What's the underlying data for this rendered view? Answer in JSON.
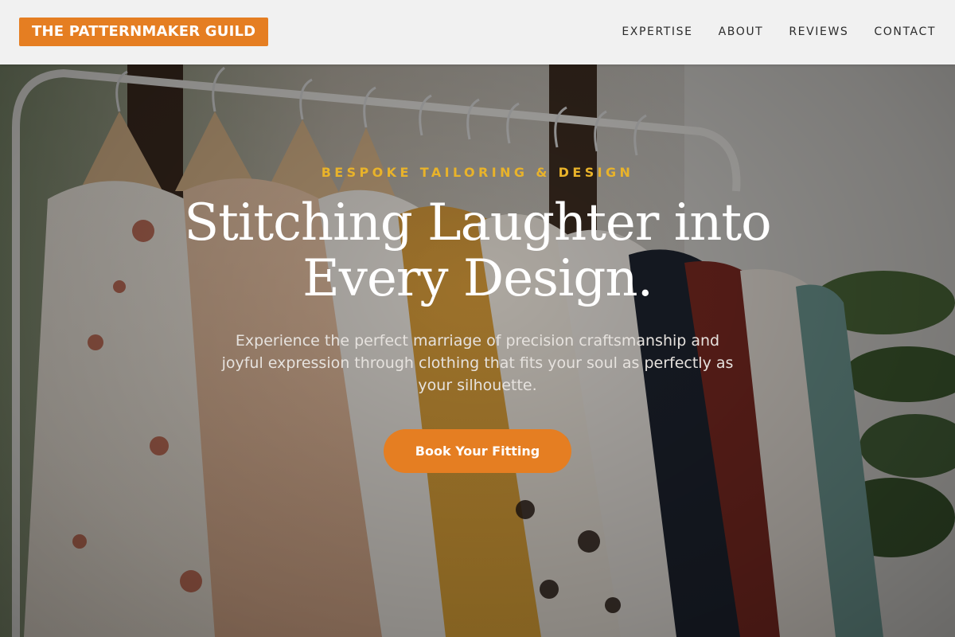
{
  "header": {
    "logo_text": "THE PATTERNMAKER GUILD",
    "nav": [
      {
        "label": "EXPERTISE"
      },
      {
        "label": "ABOUT"
      },
      {
        "label": "REVIEWS"
      },
      {
        "label": "CONTACT"
      }
    ]
  },
  "hero": {
    "eyebrow": "BESPOKE TAILORING & DESIGN",
    "headline_line1": "Stitching Laughter into",
    "headline_line2": "Every Design.",
    "subtext": "Experience the perfect marriage of precision craftsmanship and joyful expression through clothing that fits your soul as perfectly as your silhouette.",
    "cta_label": "Book Your Fitting",
    "background_image": "clothing-rack-photo"
  },
  "colors": {
    "accent": "#e57e22",
    "eyebrow": "#e9b32a",
    "header_bg": "#f1f1f1"
  }
}
